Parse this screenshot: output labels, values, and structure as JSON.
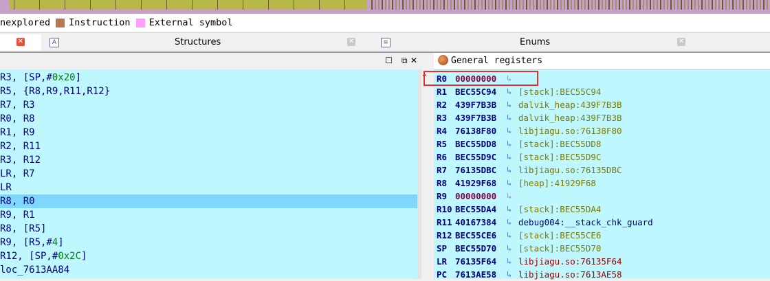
{
  "nav_band": {
    "colors": {
      "base": "#c9a0c8",
      "code": "#b8b84a",
      "data": "#a09070",
      "dark": "#6a5a30"
    }
  },
  "legend": {
    "items": [
      {
        "label": "nexplored",
        "color": "#b08050"
      },
      {
        "label": "Instruction",
        "color": "#b87850"
      },
      {
        "label": "External symbol",
        "color": "#ff9eff"
      }
    ]
  },
  "tabs": [
    {
      "label": "",
      "icon": "close-icon",
      "active": true
    },
    {
      "label": "Structures",
      "icon": "structures-icon"
    },
    {
      "label": "Enums",
      "icon": "enums-icon"
    }
  ],
  "code": {
    "lines": [
      {
        "text": "R3, [SP,#",
        "imm": "0x20",
        "post": "]"
      },
      {
        "text": "R5, {R8,R9,R11,R12}"
      },
      {
        "text": "R7, R3"
      },
      {
        "text": "R0, R8"
      },
      {
        "text": "R1, R9"
      },
      {
        "text": "R2, R11"
      },
      {
        "text": "R3, R12"
      },
      {
        "text": "LR, R7"
      },
      {
        "text": "LR"
      },
      {
        "text": "R8, R0",
        "selected": true
      },
      {
        "text": "R9, R1"
      },
      {
        "text": "R8, [R5]"
      },
      {
        "text": "R9, [R5,#",
        "imm": "4",
        "post": "]"
      },
      {
        "text": "R12, [SP,#",
        "imm": "0x2C",
        "post": "]"
      },
      {
        "text": "loc_7613AA84"
      }
    ]
  },
  "registers": {
    "title": "General registers",
    "rows": [
      {
        "name": "R0",
        "value": "00000000",
        "desc": "",
        "desc_color": "#7a7a00",
        "zero": true
      },
      {
        "name": "R1",
        "value": "BEC55C94",
        "desc": "[stack]:BEC55C94",
        "desc_color": "#7a7a00"
      },
      {
        "name": "R2",
        "value": "439F7B3B",
        "desc": "dalvik_heap:439F7B3B",
        "desc_color": "#7a7a00"
      },
      {
        "name": "R3",
        "value": "439F7B3B",
        "desc": "dalvik_heap:439F7B3B",
        "desc_color": "#7a7a00"
      },
      {
        "name": "R4",
        "value": "76138F80",
        "desc": "libjiagu.so:76138F80",
        "desc_color": "#7a7a00"
      },
      {
        "name": "R5",
        "value": "BEC55DD8",
        "desc": "[stack]:BEC55DD8",
        "desc_color": "#7a7a00"
      },
      {
        "name": "R6",
        "value": "BEC55D9C",
        "desc": "[stack]:BEC55D9C",
        "desc_color": "#7a7a00"
      },
      {
        "name": "R7",
        "value": "76135DBC",
        "desc": "libjiagu.so:76135DBC",
        "desc_color": "#7a7a00"
      },
      {
        "name": "R8",
        "value": "41929F68",
        "desc": "[heap]:41929F68",
        "desc_color": "#7a7a00"
      },
      {
        "name": "R9",
        "value": "00000000",
        "desc": "",
        "desc_color": "#7a7a00",
        "zero": true
      },
      {
        "name": "R10",
        "value": "BEC55DA4",
        "desc": "[stack]:BEC55DA4",
        "desc_color": "#7a7a00"
      },
      {
        "name": "R11",
        "value": "40167384",
        "desc": "debug004:__stack_chk_guard",
        "desc_color": "#000080"
      },
      {
        "name": "R12",
        "value": "BEC55CE6",
        "desc": "[stack]:BEC55CE6",
        "desc_color": "#7a7a00"
      },
      {
        "name": "SP",
        "value": "BEC55D70",
        "desc": "[stack]:BEC55D70",
        "desc_color": "#7a7a00"
      },
      {
        "name": "LR",
        "value": "76135F64",
        "desc": "libjiagu.so:76135F64",
        "desc_color": "#a00000"
      },
      {
        "name": "PC",
        "value": "7613AE58",
        "desc": "libjiagu.so:7613AE58",
        "desc_color": "#a00000"
      }
    ]
  }
}
